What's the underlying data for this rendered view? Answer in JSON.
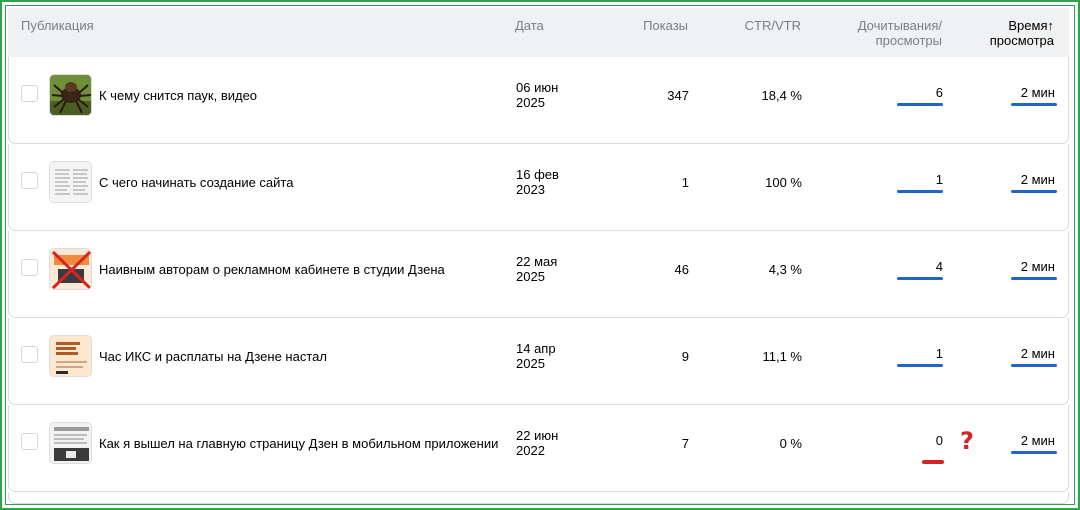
{
  "header": {
    "publication": "Публикация",
    "date": "Дата",
    "views": "Показы",
    "ctr": "CTR/VTR",
    "read_line1": "Дочитывания/",
    "read_line2": "просмотры",
    "time_line1": "Время",
    "time_line2": "просмотра",
    "sort_icon": "↑"
  },
  "rows": [
    {
      "title": "К чему снится паук, видео",
      "date_line1": "06 июн",
      "date_line2": "2025",
      "views": "347",
      "ctr": "18,4 %",
      "reads": "6",
      "time": "2 мин"
    },
    {
      "title": "С чего начинать создание сайта",
      "date_line1": "16 фев",
      "date_line2": "2023",
      "views": "1",
      "ctr": "100 %",
      "reads": "1",
      "time": "2 мин"
    },
    {
      "title": "Наивным авторам о рекламном кабинете в студии Дзена",
      "date_line1": "22 мая",
      "date_line2": "2025",
      "views": "46",
      "ctr": "4,3 %",
      "reads": "4",
      "time": "2 мин"
    },
    {
      "title": "Час ИКС и расплаты на Дзене настал",
      "date_line1": "14 апр",
      "date_line2": "2025",
      "views": "9",
      "ctr": "11,1 %",
      "reads": "1",
      "time": "2 мин"
    },
    {
      "title": "Как я вышел на главную страницу Дзен в мобильном приложении",
      "date_line1": "22 июн",
      "date_line2": "2022",
      "views": "7",
      "ctr": "0 %",
      "reads": "0",
      "time": "2 мин"
    }
  ],
  "annotation": {
    "mark": "?",
    "color": "#d52424"
  },
  "colors": {
    "bar": "#2166c4",
    "frame": "#2fa24a"
  }
}
